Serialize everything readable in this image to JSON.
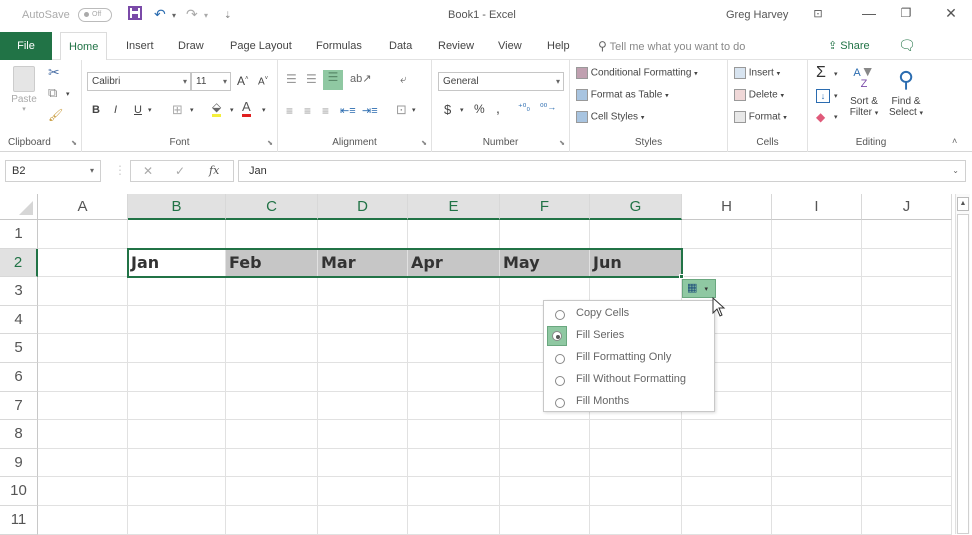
{
  "titlebar": {
    "autosave_label": "AutoSave",
    "autosave_state": "Off",
    "document_title": "Book1 - Excel",
    "user_name": "Greg Harvey",
    "icons": [
      "save-icon",
      "undo-icon",
      "redo-icon",
      "customize-qat-icon",
      "ribbon-display-options-icon",
      "minimize-icon",
      "restore-icon",
      "close-icon"
    ]
  },
  "tabs": {
    "items": [
      "File",
      "Home",
      "Insert",
      "Draw",
      "Page Layout",
      "Formulas",
      "Data",
      "Review",
      "View",
      "Help"
    ],
    "active": "Home",
    "tell_me_placeholder": "Tell me what you want to do",
    "share_label": "Share"
  },
  "ribbon": {
    "clipboard": {
      "label": "Clipboard",
      "paste_label": "Paste"
    },
    "font": {
      "label": "Font",
      "font_name": "Calibri",
      "font_size": "11",
      "bold": "B",
      "italic": "I",
      "underline": "U"
    },
    "alignment": {
      "label": "Alignment"
    },
    "number": {
      "label": "Number",
      "format": "General",
      "currency": "$",
      "percent": "%",
      "comma": ","
    },
    "styles": {
      "label": "Styles",
      "conditional_formatting": "Conditional Formatting",
      "format_as_table": "Format as Table",
      "cell_styles": "Cell Styles"
    },
    "cells": {
      "label": "Cells",
      "insert": "Insert",
      "delete": "Delete",
      "format": "Format"
    },
    "editing": {
      "label": "Editing",
      "sum": "Σ",
      "sort_filter_1": "Sort &",
      "sort_filter_2": "Filter",
      "find_select_1": "Find &",
      "find_select_2": "Select"
    }
  },
  "formula_bar": {
    "name_box": "B2",
    "cancel": "✕",
    "enter": "✓",
    "fx": "fx",
    "content": "Jan"
  },
  "sheet": {
    "columns": [
      "A",
      "B",
      "C",
      "D",
      "E",
      "F",
      "G",
      "H",
      "I",
      "J"
    ],
    "selected_columns": [
      "B",
      "C",
      "D",
      "E",
      "F",
      "G"
    ],
    "rows": [
      "1",
      "2",
      "3",
      "4",
      "5",
      "6",
      "7",
      "8",
      "9",
      "10",
      "11"
    ],
    "selected_row": "2",
    "row2_values": [
      "Jan",
      "Feb",
      "Mar",
      "Apr",
      "May",
      "Jun"
    ]
  },
  "autofill_options": {
    "items": [
      {
        "label": "Copy Cells",
        "checked": false
      },
      {
        "label": "Fill Series",
        "checked": true
      },
      {
        "label": "Fill Formatting Only",
        "checked": false
      },
      {
        "label": "Fill Without Formatting",
        "checked": false
      },
      {
        "label": "Fill Months",
        "checked": false
      }
    ]
  },
  "colors": {
    "excel_green": "#217346",
    "selection_fill": "#c6c6c6",
    "autofill_highlight": "#8fc8a2"
  }
}
